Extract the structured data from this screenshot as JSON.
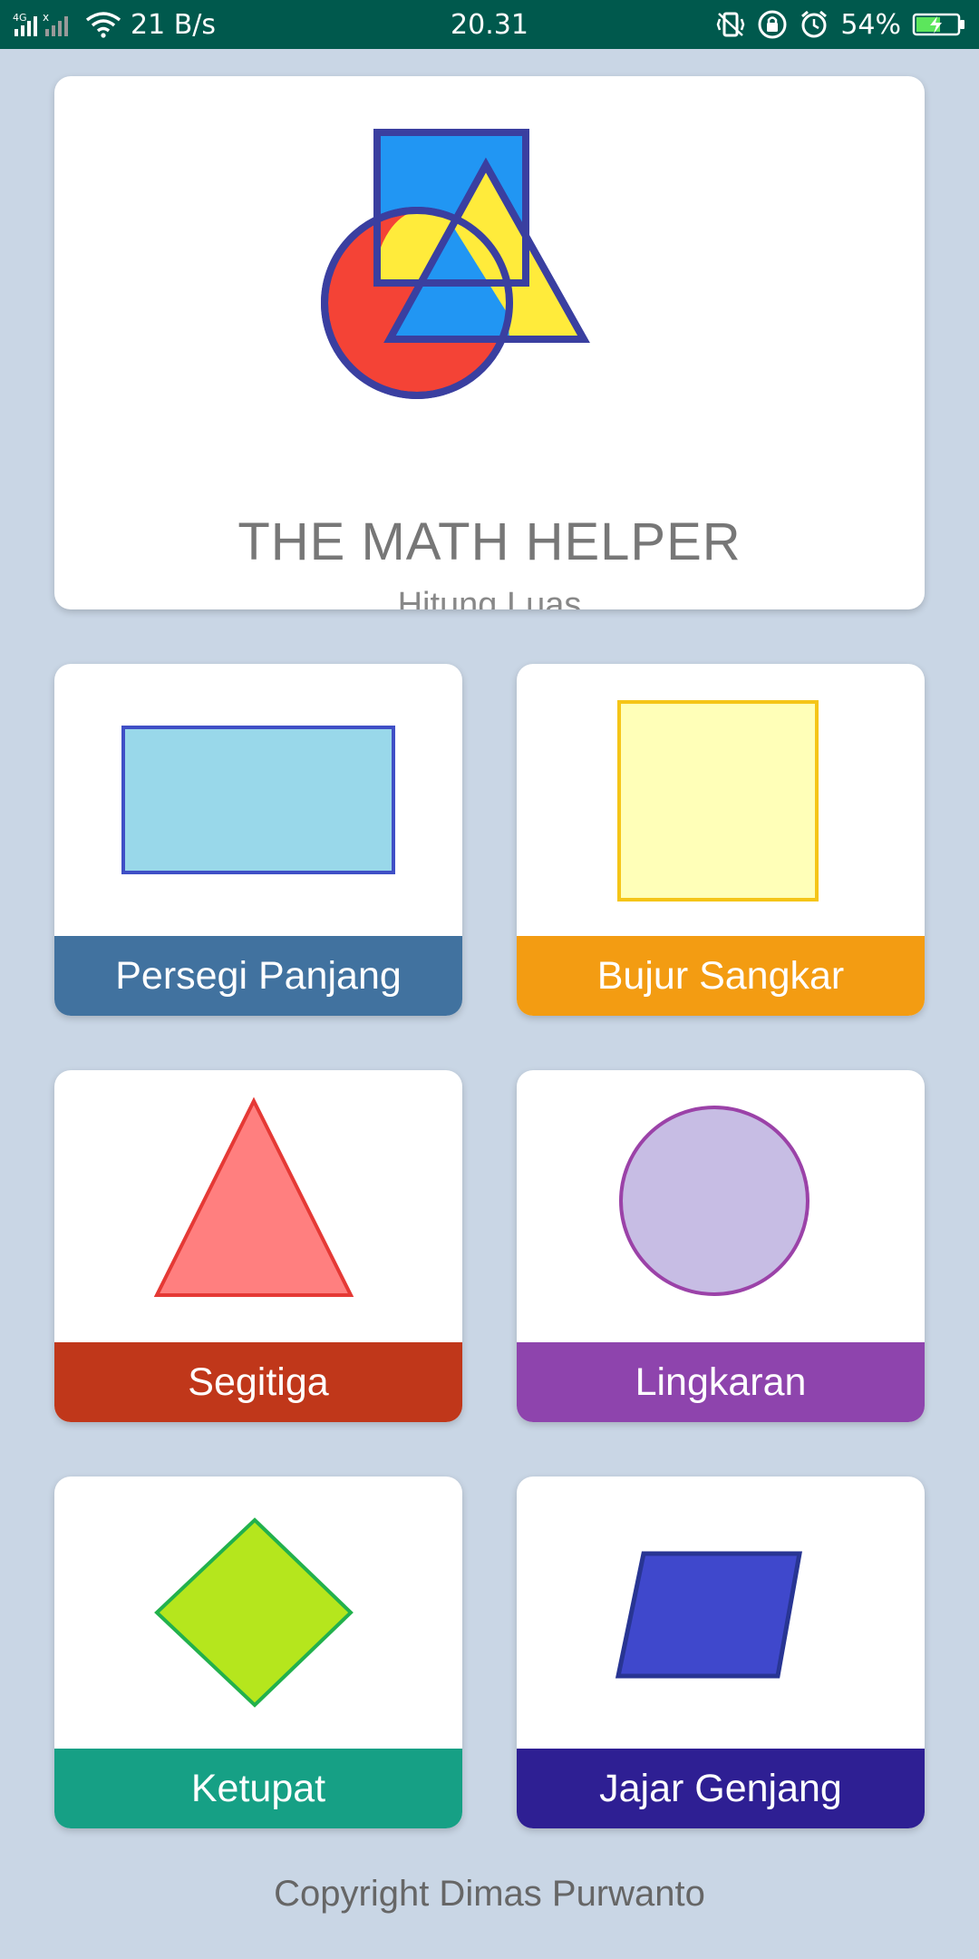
{
  "status_bar": {
    "network": "4G",
    "speed": "21 B/s",
    "time": "20.31",
    "battery": "54%",
    "icons": [
      "signal-icon",
      "wifi-icon",
      "vibrate-icon",
      "lock-icon",
      "alarm-icon",
      "battery-charging-icon"
    ]
  },
  "header": {
    "title": "THE MATH HELPER",
    "subtitle": "Hitung Luas"
  },
  "shapes": [
    {
      "label": "Persegi Panjang",
      "color": "#41729f",
      "icon": "rectangle-icon",
      "fill": "#99d8ea",
      "stroke": "#3f4fc6"
    },
    {
      "label": "Bujur Sangkar",
      "color": "#f39c12",
      "icon": "square-icon",
      "fill": "#ffffb8",
      "stroke": "#f5c518"
    },
    {
      "label": "Segitiga",
      "color": "#c0371a",
      "icon": "triangle-icon",
      "fill": "#ff7f7f",
      "stroke": "#e53935"
    },
    {
      "label": "Lingkaran",
      "color": "#8e44ad",
      "icon": "circle-icon",
      "fill": "#c7bde4",
      "stroke": "#9b42a8"
    },
    {
      "label": "Ketupat",
      "color": "#16a085",
      "icon": "rhombus-icon",
      "fill": "#b5e61d",
      "stroke": "#22b14c"
    },
    {
      "label": "Jajar Genjang",
      "color": "#2e1f93",
      "icon": "parallelogram-icon",
      "fill": "#3f48cc",
      "stroke": "#283593"
    }
  ],
  "footer": {
    "copyright": "Copyright Dimas Purwanto"
  },
  "colors": {
    "background": "#c9d6e5",
    "status_bar": "#00594d"
  }
}
